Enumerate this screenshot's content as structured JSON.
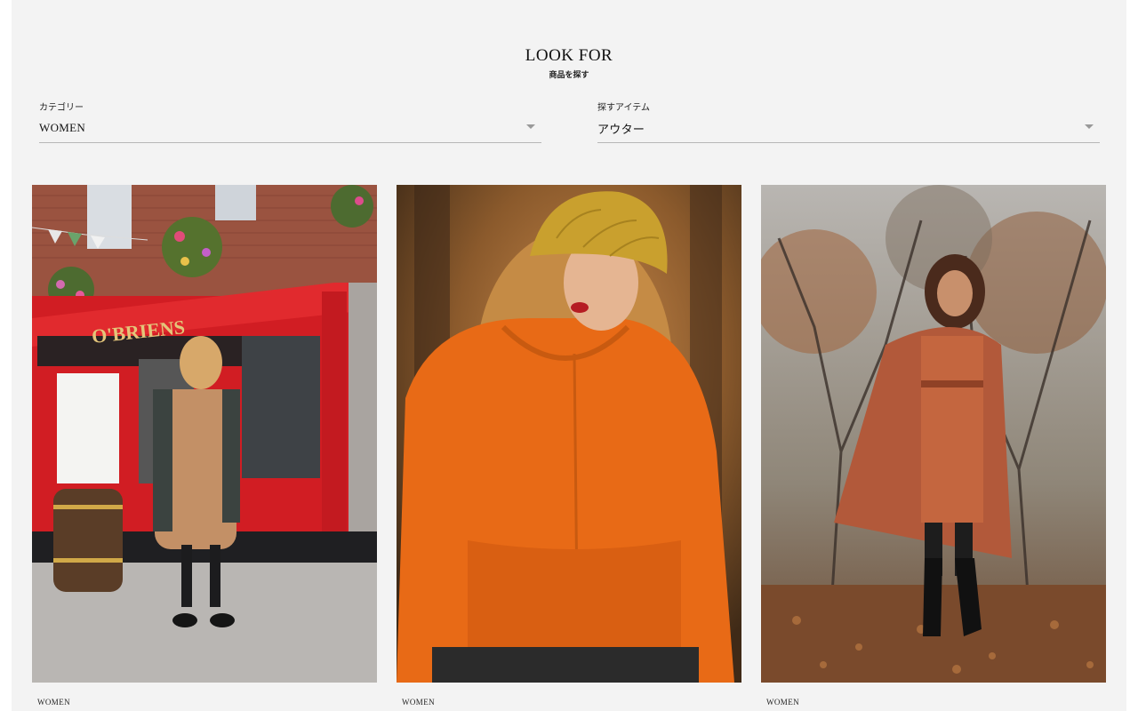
{
  "header": {
    "title": "LOOK FOR",
    "subtitle": "商品を探す"
  },
  "filters": {
    "category": {
      "label": "カテゴリー",
      "value": "WOMEN",
      "icon": "chevron-down-icon"
    },
    "item": {
      "label": "探すアイテム",
      "value": "アウター",
      "icon": "chevron-down-icon"
    }
  },
  "products": [
    {
      "category": "WOMEN",
      "image": "woman-in-camel-coat-red-storefront"
    },
    {
      "category": "WOMEN",
      "image": "woman-in-orange-hoodie-yellow-beanie"
    },
    {
      "category": "WOMEN",
      "image": "woman-in-rust-cape-coat-autumn-park"
    }
  ],
  "colors": {
    "page_background": "#f3f3f3",
    "text": "#111111",
    "divider": "#b7b7b7"
  }
}
